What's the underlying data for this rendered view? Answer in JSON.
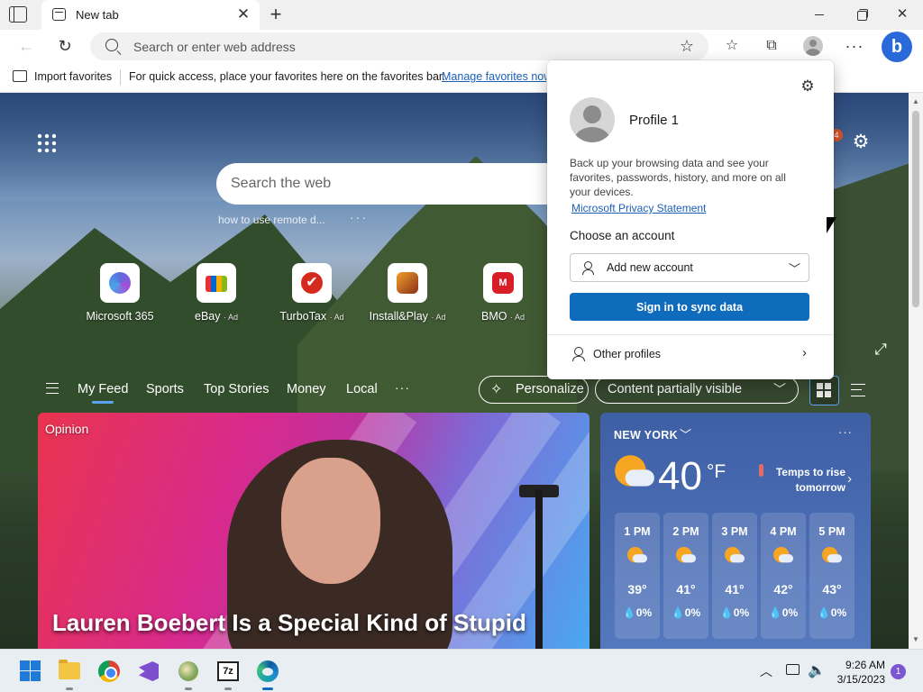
{
  "window": {
    "tab_title": "New tab",
    "tab_close_glyph": "✕",
    "new_tab_glyph": "+",
    "minimize_glyph": "",
    "close_glyph": "✕"
  },
  "toolbar": {
    "back_glyph": "←",
    "refresh_glyph": "↻",
    "address_placeholder": "Search or enter web address",
    "add_favorite_glyph": "☆",
    "favorites_glyph": "☆",
    "collections_glyph": "⧉",
    "more_glyph": "···",
    "bing_glyph": "b"
  },
  "favorites_bar": {
    "import_label": "Import favorites",
    "message": "For quick access, place your favorites here on the favorites bar.",
    "manage_link": "Manage favorites now"
  },
  "page": {
    "search_placeholder": "Search the web",
    "trending": "how to use remote d...",
    "trending_more": "···",
    "notification_count": "4",
    "gear_glyph": "⚙",
    "expand_glyph": "⤢",
    "quick_links": [
      {
        "label": "Microsoft 365",
        "ad": ""
      },
      {
        "label": "eBay",
        "ad": "· Ad"
      },
      {
        "label": "TurboTax",
        "ad": "· Ad",
        "glyph": "✔"
      },
      {
        "label": "Install&Play",
        "ad": "· Ad"
      },
      {
        "label": "BMO",
        "ad": "· Ad",
        "glyph": "M"
      }
    ]
  },
  "feed": {
    "tabs": [
      "My Feed",
      "Sports",
      "Top Stories",
      "Money",
      "Local"
    ],
    "more": "···",
    "personalize": "Personalize",
    "personalize_glyph": "✧",
    "content_visibility": "Content partially visible",
    "chevron": "﹀"
  },
  "hero": {
    "tag": "Opinion",
    "headline": "Lauren Boebert Is a Special Kind of Stupid"
  },
  "weather": {
    "location": "NEW YORK",
    "location_chevron": "﹀",
    "more": "···",
    "temp": "40",
    "unit": "°F",
    "note": "Temps to rise tomorrow",
    "note_chevron": "›",
    "hours": [
      {
        "time": "1 PM",
        "temp": "39°",
        "precip": "💧0%"
      },
      {
        "time": "2 PM",
        "temp": "41°",
        "precip": "💧0%"
      },
      {
        "time": "3 PM",
        "temp": "41°",
        "precip": "💧0%"
      },
      {
        "time": "4 PM",
        "temp": "42°",
        "precip": "💧0%"
      },
      {
        "time": "5 PM",
        "temp": "43°",
        "precip": "💧0%"
      }
    ]
  },
  "scrollbar": {
    "up_glyph": "▲",
    "down_glyph": "▼"
  },
  "profile_flyout": {
    "gear_glyph": "⚙",
    "name": "Profile 1",
    "description": "Back up your browsing data and see your favorites, passwords, history, and more on all your devices.",
    "privacy_link": "Microsoft Privacy Statement",
    "choose_account": "Choose an account",
    "add_account": "Add new account",
    "select_chevron": "﹀",
    "sign_in": "Sign in to sync data",
    "other_profiles": "Other profiles",
    "other_chevron": "›"
  },
  "taskbar": {
    "seven_zip_label": "7z",
    "tray_chevron": "︿",
    "volume_glyph": "🔈",
    "time": "9:26 AM",
    "date": "3/15/2023",
    "notification_count": "1"
  }
}
